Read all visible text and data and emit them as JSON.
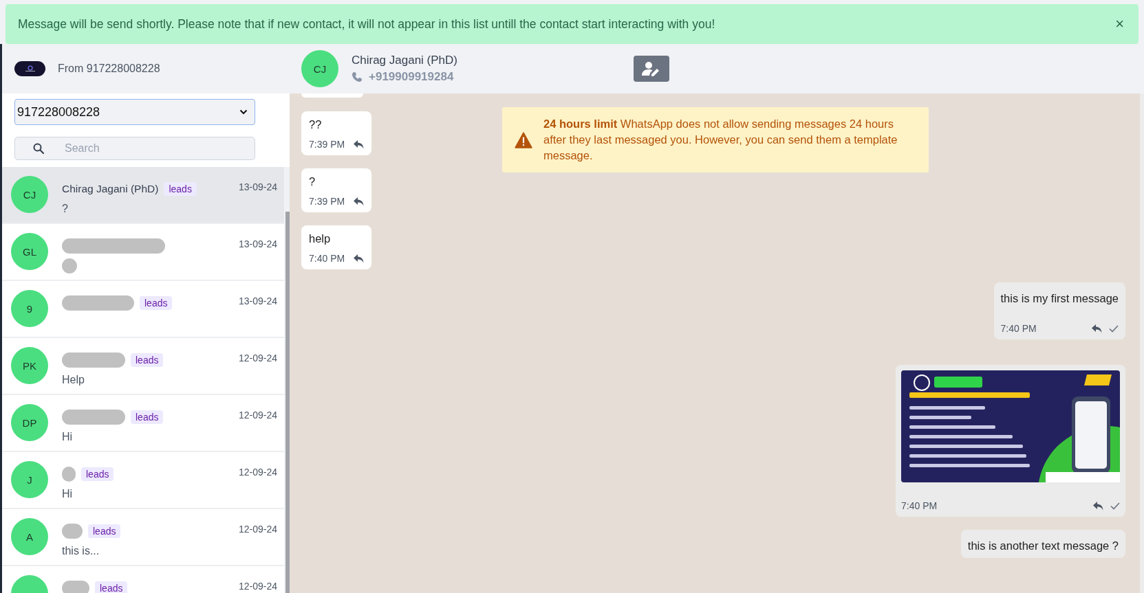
{
  "notice": {
    "text": "Message will be send shortly. Please note that if new contact, it will not appear in this list untill the contact start interacting with you!",
    "close": "×"
  },
  "sender": {
    "label": "From 917228008228",
    "number": "917228008228",
    "search_placeholder": "Search"
  },
  "contacts": [
    {
      "initials": "CJ",
      "name": "Chirag Jagani (PhD)",
      "redacted": false,
      "tag": "leads",
      "date": "13-09-24",
      "preview": "?",
      "preview_redacted": false,
      "selected": true
    },
    {
      "initials": "GL",
      "redacted": true,
      "date": "13-09-24",
      "preview_redacted": true,
      "selected": false
    },
    {
      "initials": "9",
      "redacted": true,
      "tag": "leads",
      "date": "13-09-24",
      "preview_redacted": false,
      "selected": false
    },
    {
      "initials": "PK",
      "redacted": true,
      "tag": "leads",
      "date": "12-09-24",
      "preview": "Help",
      "preview_redacted": false,
      "selected": false
    },
    {
      "initials": "DP",
      "redacted": true,
      "tag": "leads",
      "date": "12-09-24",
      "preview": "Hi",
      "preview_redacted": false,
      "selected": false
    },
    {
      "initials": "J",
      "redacted": true,
      "tag": "leads",
      "date": "12-09-24",
      "preview": "Hi",
      "preview_redacted": false,
      "selected": false
    },
    {
      "initials": "A",
      "redacted": true,
      "tag": "leads",
      "date": "12-09-24",
      "preview": "this is...",
      "preview_redacted": false,
      "selected": false
    },
    {
      "redacted": true,
      "tag": "leads",
      "date": "12-09-24",
      "preview_redacted": false,
      "selected": false
    }
  ],
  "chat": {
    "initials": "CJ",
    "name": "Chirag Jagani (PhD)",
    "phone": "+919909919284",
    "warning": {
      "title": "24 hours limit",
      "text": "WhatsApp does not allow sending messages 24 hours after they last messaged you. However, you can send them a template message."
    },
    "messages": [
      {
        "outgoing": false,
        "kind": "text",
        "text": "??",
        "time": "7:39 PM"
      },
      {
        "outgoing": false,
        "kind": "text",
        "text": "?",
        "time": "7:39 PM"
      },
      {
        "outgoing": false,
        "kind": "text",
        "text": "help",
        "time": "7:40 PM"
      },
      {
        "outgoing": true,
        "kind": "text",
        "text": "this is my first message",
        "time": "7:40 PM"
      },
      {
        "outgoing": true,
        "time": "7:40 PM"
      },
      {
        "outgoing": true,
        "kind": "text",
        "text": "this is another text message ?"
      }
    ]
  }
}
